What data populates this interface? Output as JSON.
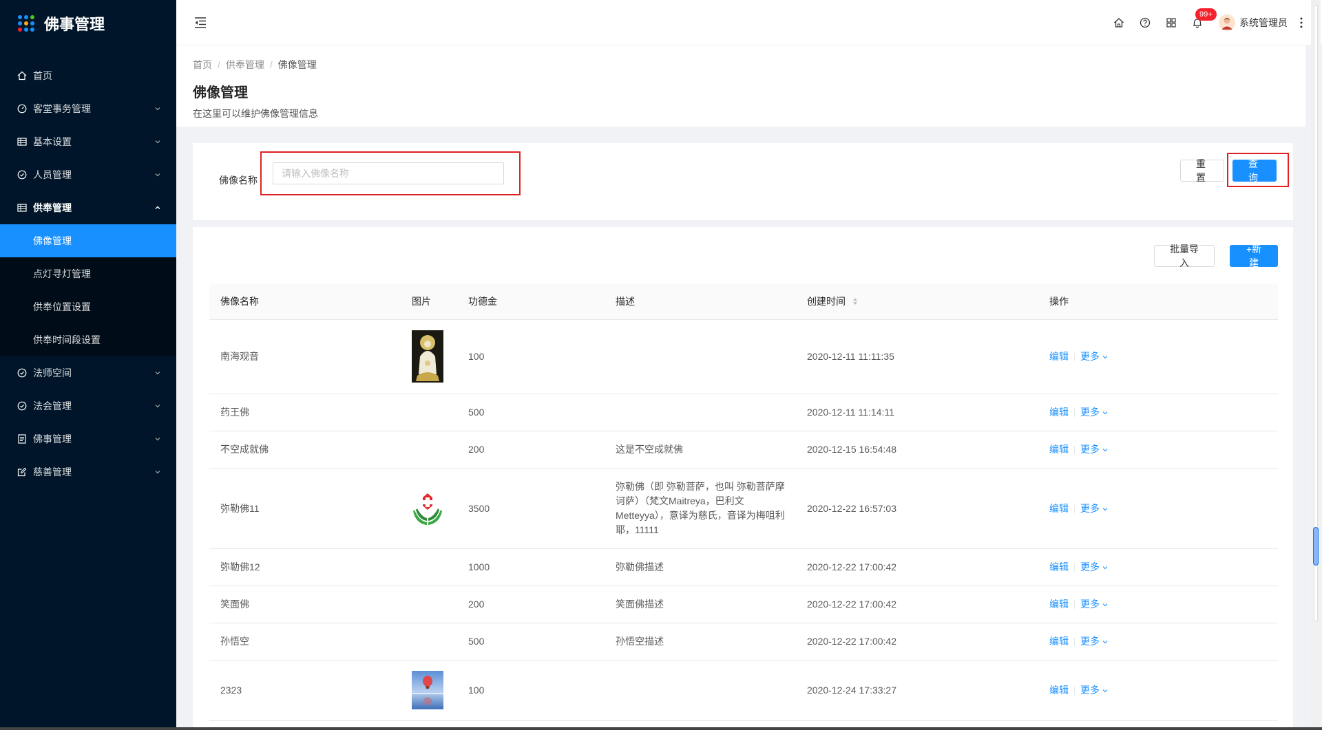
{
  "app": {
    "title": "佛事管理",
    "logo_colors": [
      "#1890ff",
      "#1890ff",
      "#52c41a",
      "#1890ff",
      "#faad14",
      "#1890ff",
      "#f5222d",
      "#1890ff",
      "#1890ff"
    ]
  },
  "sidebar": {
    "items": [
      {
        "label": "首页",
        "icon": "home-icon"
      },
      {
        "label": "客堂事务管理",
        "icon": "dashboard-icon",
        "arrow": "chevron-down-icon"
      },
      {
        "label": "基本设置",
        "icon": "table-icon",
        "arrow": "chevron-down-icon"
      },
      {
        "label": "人员管理",
        "icon": "check-circle-icon",
        "arrow": "chevron-down-icon"
      },
      {
        "label": "供奉管理",
        "icon": "table-icon",
        "arrow": "chevron-up-icon"
      },
      {
        "label": "法师空间",
        "icon": "check-circle-icon",
        "arrow": "chevron-down-icon"
      },
      {
        "label": "法会管理",
        "icon": "check-circle-icon",
        "arrow": "chevron-down-icon"
      },
      {
        "label": "佛事管理",
        "icon": "profile-icon",
        "arrow": "chevron-down-icon"
      },
      {
        "label": "慈善管理",
        "icon": "edit-icon",
        "arrow": "chevron-down-icon"
      }
    ],
    "submenu": [
      {
        "label": "佛像管理",
        "active": true
      },
      {
        "label": "点灯寻灯管理"
      },
      {
        "label": "供奉位置设置"
      },
      {
        "label": "供奉时间段设置"
      }
    ]
  },
  "header": {
    "notification_badge": "99+",
    "user_name": "系统管理员"
  },
  "page": {
    "breadcrumb": [
      "首页",
      "供奉管理",
      "佛像管理"
    ],
    "title": "佛像管理",
    "description": "在这里可以维护佛像管理信息"
  },
  "search": {
    "label": "佛像名称",
    "placeholder": "请输入佛像名称",
    "value": "",
    "reset_label": "重 置",
    "query_label": "查 询"
  },
  "toolbar": {
    "import_label": "批量导入",
    "new_label": "+新建"
  },
  "table": {
    "columns": [
      "佛像名称",
      "图片",
      "功德金",
      "描述",
      "创建时间",
      "操作"
    ],
    "rows": [
      {
        "name": "南海观音",
        "image": "guanyin",
        "amount": "100",
        "desc": "",
        "created": "2020-12-11 11:11:35"
      },
      {
        "name": "药王佛",
        "image": "",
        "amount": "500",
        "desc": "",
        "created": "2020-12-11 11:14:11"
      },
      {
        "name": "不空成就佛",
        "image": "",
        "amount": "200",
        "desc": "这是不空成就佛",
        "created": "2020-12-15 16:54:48"
      },
      {
        "name": "弥勒佛11",
        "image": "redcross",
        "amount": "3500",
        "desc": "弥勒佛（即 弥勒菩萨，也叫 弥勒菩萨摩诃萨）（梵文Maitreya，巴利文Metteyya），意译为慈氏，音译为梅咀利耶，11111",
        "created": "2020-12-22 16:57:03"
      },
      {
        "name": "弥勒佛12",
        "image": "",
        "amount": "1000",
        "desc": "弥勒佛描述",
        "created": "2020-12-22 17:00:42"
      },
      {
        "name": "笑面佛",
        "image": "",
        "amount": "200",
        "desc": "笑面佛描述",
        "created": "2020-12-22 17:00:42"
      },
      {
        "name": "孙悟空",
        "image": "",
        "amount": "500",
        "desc": "孙悟空描述",
        "created": "2020-12-22 17:00:42"
      },
      {
        "name": "2323",
        "image": "balloon",
        "amount": "100",
        "desc": "",
        "created": "2020-12-24 17:33:27"
      }
    ],
    "action_edit": "编辑",
    "action_more": "更多"
  }
}
